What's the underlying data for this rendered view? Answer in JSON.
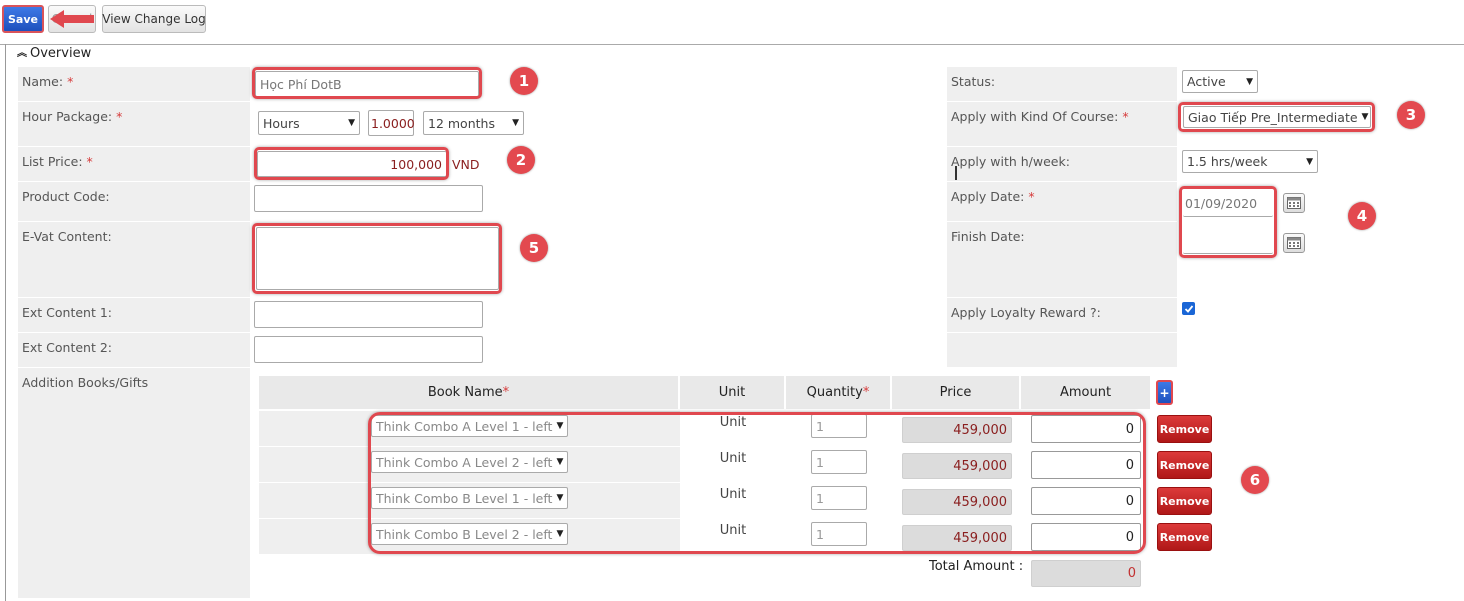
{
  "toolbar": {
    "save_label": "Save",
    "cancel_label": "Cancel",
    "change_log_label": "View Change Log"
  },
  "section": {
    "title": "Overview",
    "toggle_icon": "double-chevron-up-icon"
  },
  "left_fields": {
    "name": {
      "label": "Name:",
      "required": "*",
      "value": "Học Phí DotB"
    },
    "hour_package": {
      "label": "Hour Package:",
      "required": "*",
      "unit_value": "Hours",
      "hours_value": "1.0000",
      "duration_value": "12 months"
    },
    "list_price": {
      "label": "List Price:",
      "required": "*",
      "value": "100,000",
      "currency": "VND"
    },
    "product_code": {
      "label": "Product Code:",
      "value": ""
    },
    "evat_content": {
      "label": "E-Vat Content:",
      "value": ""
    },
    "ext_content_1": {
      "label": "Ext Content 1:",
      "value": ""
    },
    "ext_content_2": {
      "label": "Ext Content 2:",
      "value": ""
    },
    "addition_books": {
      "label": "Addition Books/Gifts"
    }
  },
  "right_fields": {
    "status": {
      "label": "Status:",
      "value": "Active"
    },
    "kind_of_course": {
      "label": "Apply with Kind Of Course:",
      "required": "*",
      "value": "Giao Tiếp Pre_Intermediate"
    },
    "hours_week": {
      "label": "Apply with h/week:",
      "value": "1.5 hrs/week"
    },
    "apply_date": {
      "label": "Apply Date:",
      "required": "*",
      "value": "01/09/2020"
    },
    "finish_date": {
      "label": "Finish Date:",
      "value": ""
    },
    "loyalty": {
      "label": "Apply Loyalty Reward ?:",
      "checked": true
    }
  },
  "books_table": {
    "headers": {
      "book_name": "Book Name",
      "book_name_req": "*",
      "unit": "Unit",
      "quantity": "Quantity",
      "quantity_req": "*",
      "price": "Price",
      "amount": "Amount"
    },
    "add_button": "+",
    "rows": [
      {
        "book": "Think Combo A Level 1 - left",
        "unit": "Unit",
        "quantity": "1",
        "price": "459,000",
        "amount": "0",
        "remove": "Remove"
      },
      {
        "book": "Think Combo A Level 2 - left",
        "unit": "Unit",
        "quantity": "1",
        "price": "459,000",
        "amount": "0",
        "remove": "Remove"
      },
      {
        "book": "Think Combo B Level 1 - left",
        "unit": "Unit",
        "quantity": "1",
        "price": "459,000",
        "amount": "0",
        "remove": "Remove"
      },
      {
        "book": "Think Combo B Level 2 - left",
        "unit": "Unit",
        "quantity": "1",
        "price": "459,000",
        "amount": "0",
        "remove": "Remove"
      }
    ],
    "total_label": "Total Amount :",
    "total_value": "0"
  },
  "markers": [
    "1",
    "2",
    "3",
    "4",
    "5",
    "6"
  ],
  "colors": {
    "marker": "#e0484f",
    "save_button": "#1d50bd",
    "remove_button": "#c62828",
    "required": "#d63a3a"
  }
}
